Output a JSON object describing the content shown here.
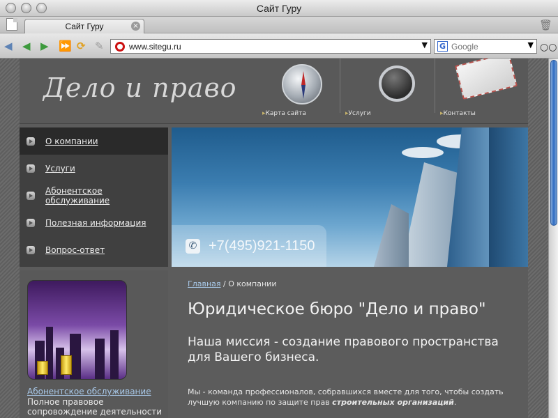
{
  "window": {
    "title": "Сайт Гуру"
  },
  "tabs": [
    {
      "label": "Сайт Гуру",
      "close": "×"
    }
  ],
  "toolbar": {
    "url": "www.sitegu.ru",
    "search_placeholder": "Google",
    "search_logo": "G",
    "dropdown": "▼"
  },
  "icons": {
    "back": "back-arrow-icon",
    "forward": "forward-arrow-icon",
    "fast_forward": "fast-forward-icon",
    "reload": "reload-icon",
    "edit": "pencil-icon",
    "trash": "trash-icon",
    "glasses": "glasses-icon"
  },
  "site": {
    "logo": "Дело и право",
    "header_links": [
      {
        "label": "Карта сайта"
      },
      {
        "label": "Услуги"
      },
      {
        "label": "Контакты"
      }
    ],
    "menu": [
      {
        "label": "О компании"
      },
      {
        "label": "Услуги"
      },
      {
        "label": "Абонентское обслуживание"
      },
      {
        "label": "Полезная информация"
      },
      {
        "label": "Вопрос-ответ"
      }
    ],
    "phone": "+7(495)921-1150",
    "promo": {
      "link": "Абонентское обслуживание",
      "text": "Полное правовое сопровождение деятельности"
    },
    "breadcrumb": {
      "home": "Главная",
      "separator": " / ",
      "current": "О компании"
    },
    "heading": "Юридическое бюро \"Дело и право\"",
    "subheading": "Наша миссия - создание правового пространства для Вашего бизнеса.",
    "paragraph_start": "Мы - команда профессионалов, собравшихся вместе для того, чтобы создать лучшую компанию по защите прав ",
    "paragraph_em": "строительных организаций",
    "paragraph_end": "."
  },
  "colors": {
    "accent_link": "#a8c8e8",
    "bg": "#5c5c5c",
    "menu_bg": "#404040"
  }
}
